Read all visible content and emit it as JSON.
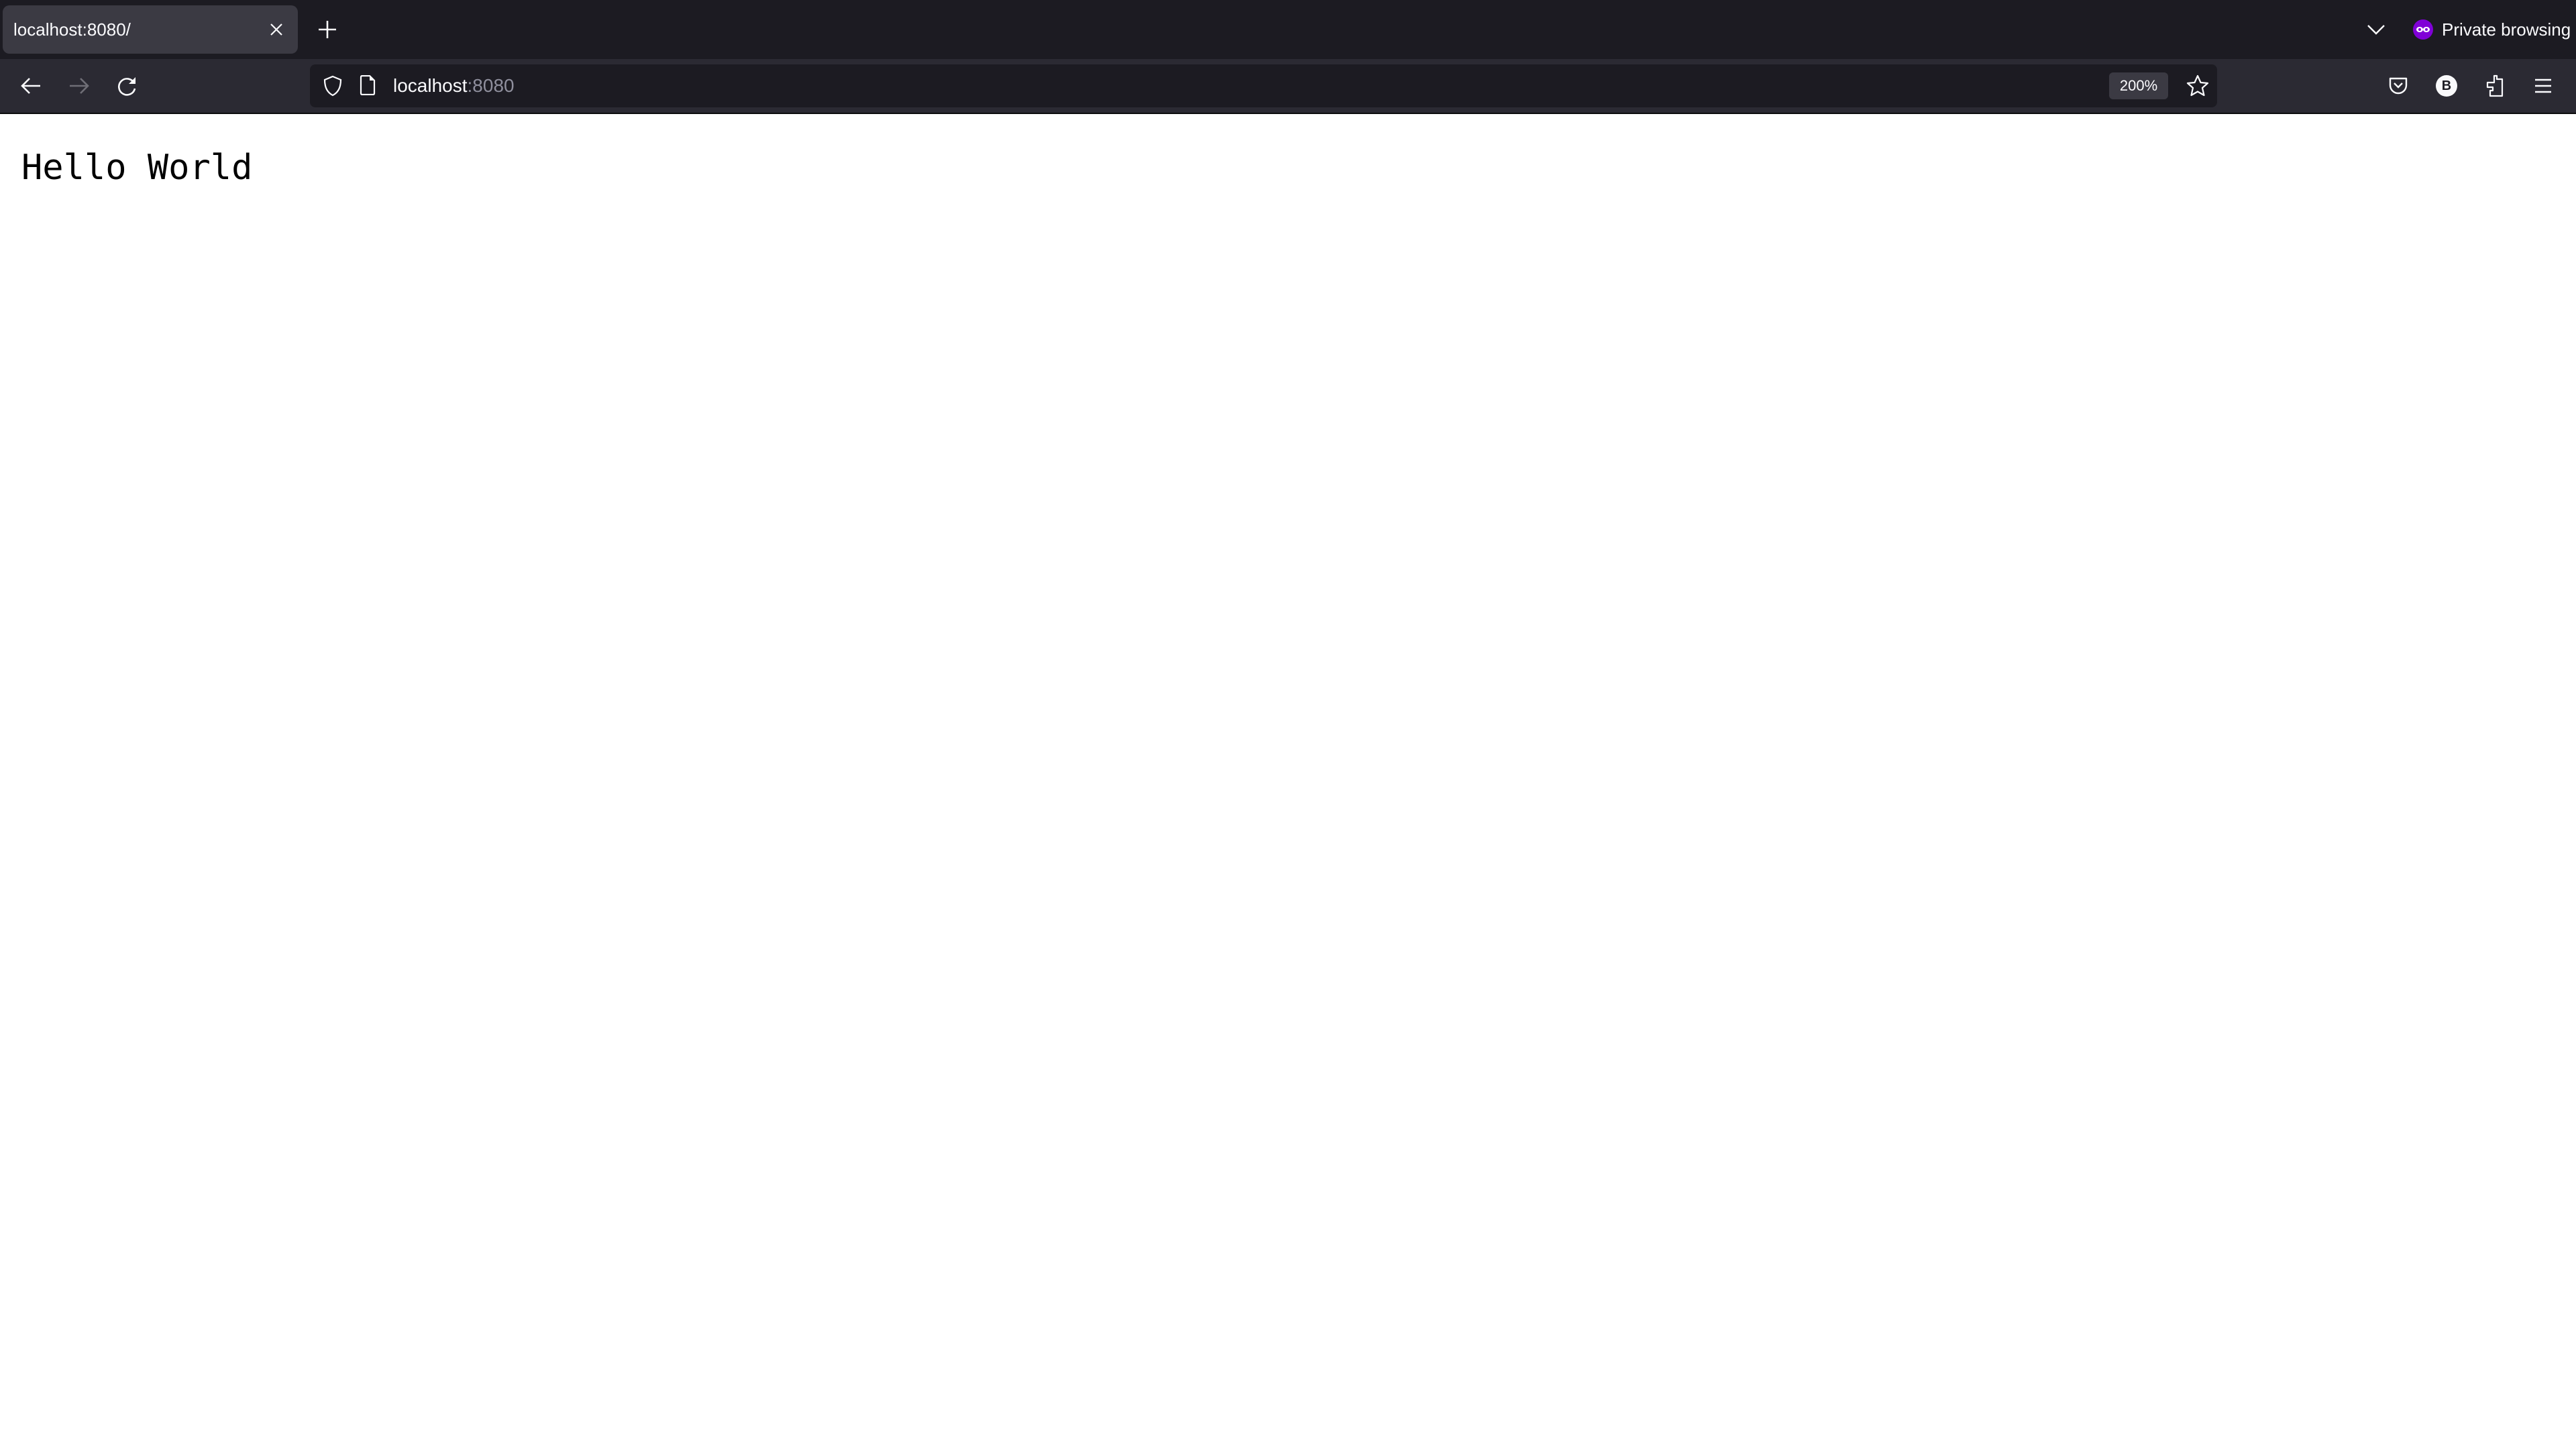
{
  "browser": {
    "tab": {
      "title": "localhost:8080/",
      "close_icon": "close-icon"
    },
    "new_tab_icon": "plus-icon",
    "tab_list_icon": "chevron-down-icon",
    "private": {
      "label": "Private browsing",
      "icon": "private-mask-icon",
      "accent": "#8000d7"
    },
    "nav": {
      "back_icon": "arrow-left-icon",
      "forward_icon": "arrow-right-icon",
      "reload_icon": "reload-icon"
    },
    "urlbar": {
      "host": "localhost",
      "port": ":8080",
      "zoom": "200%",
      "shield_icon": "shield-icon",
      "page_icon": "page-icon",
      "bookmark_icon": "star-icon"
    },
    "toolbar_icons": [
      "pocket-icon",
      "account-icon",
      "extensions-icon",
      "menu-icon"
    ],
    "account_initial": "B"
  },
  "page": {
    "text": "Hello World"
  }
}
